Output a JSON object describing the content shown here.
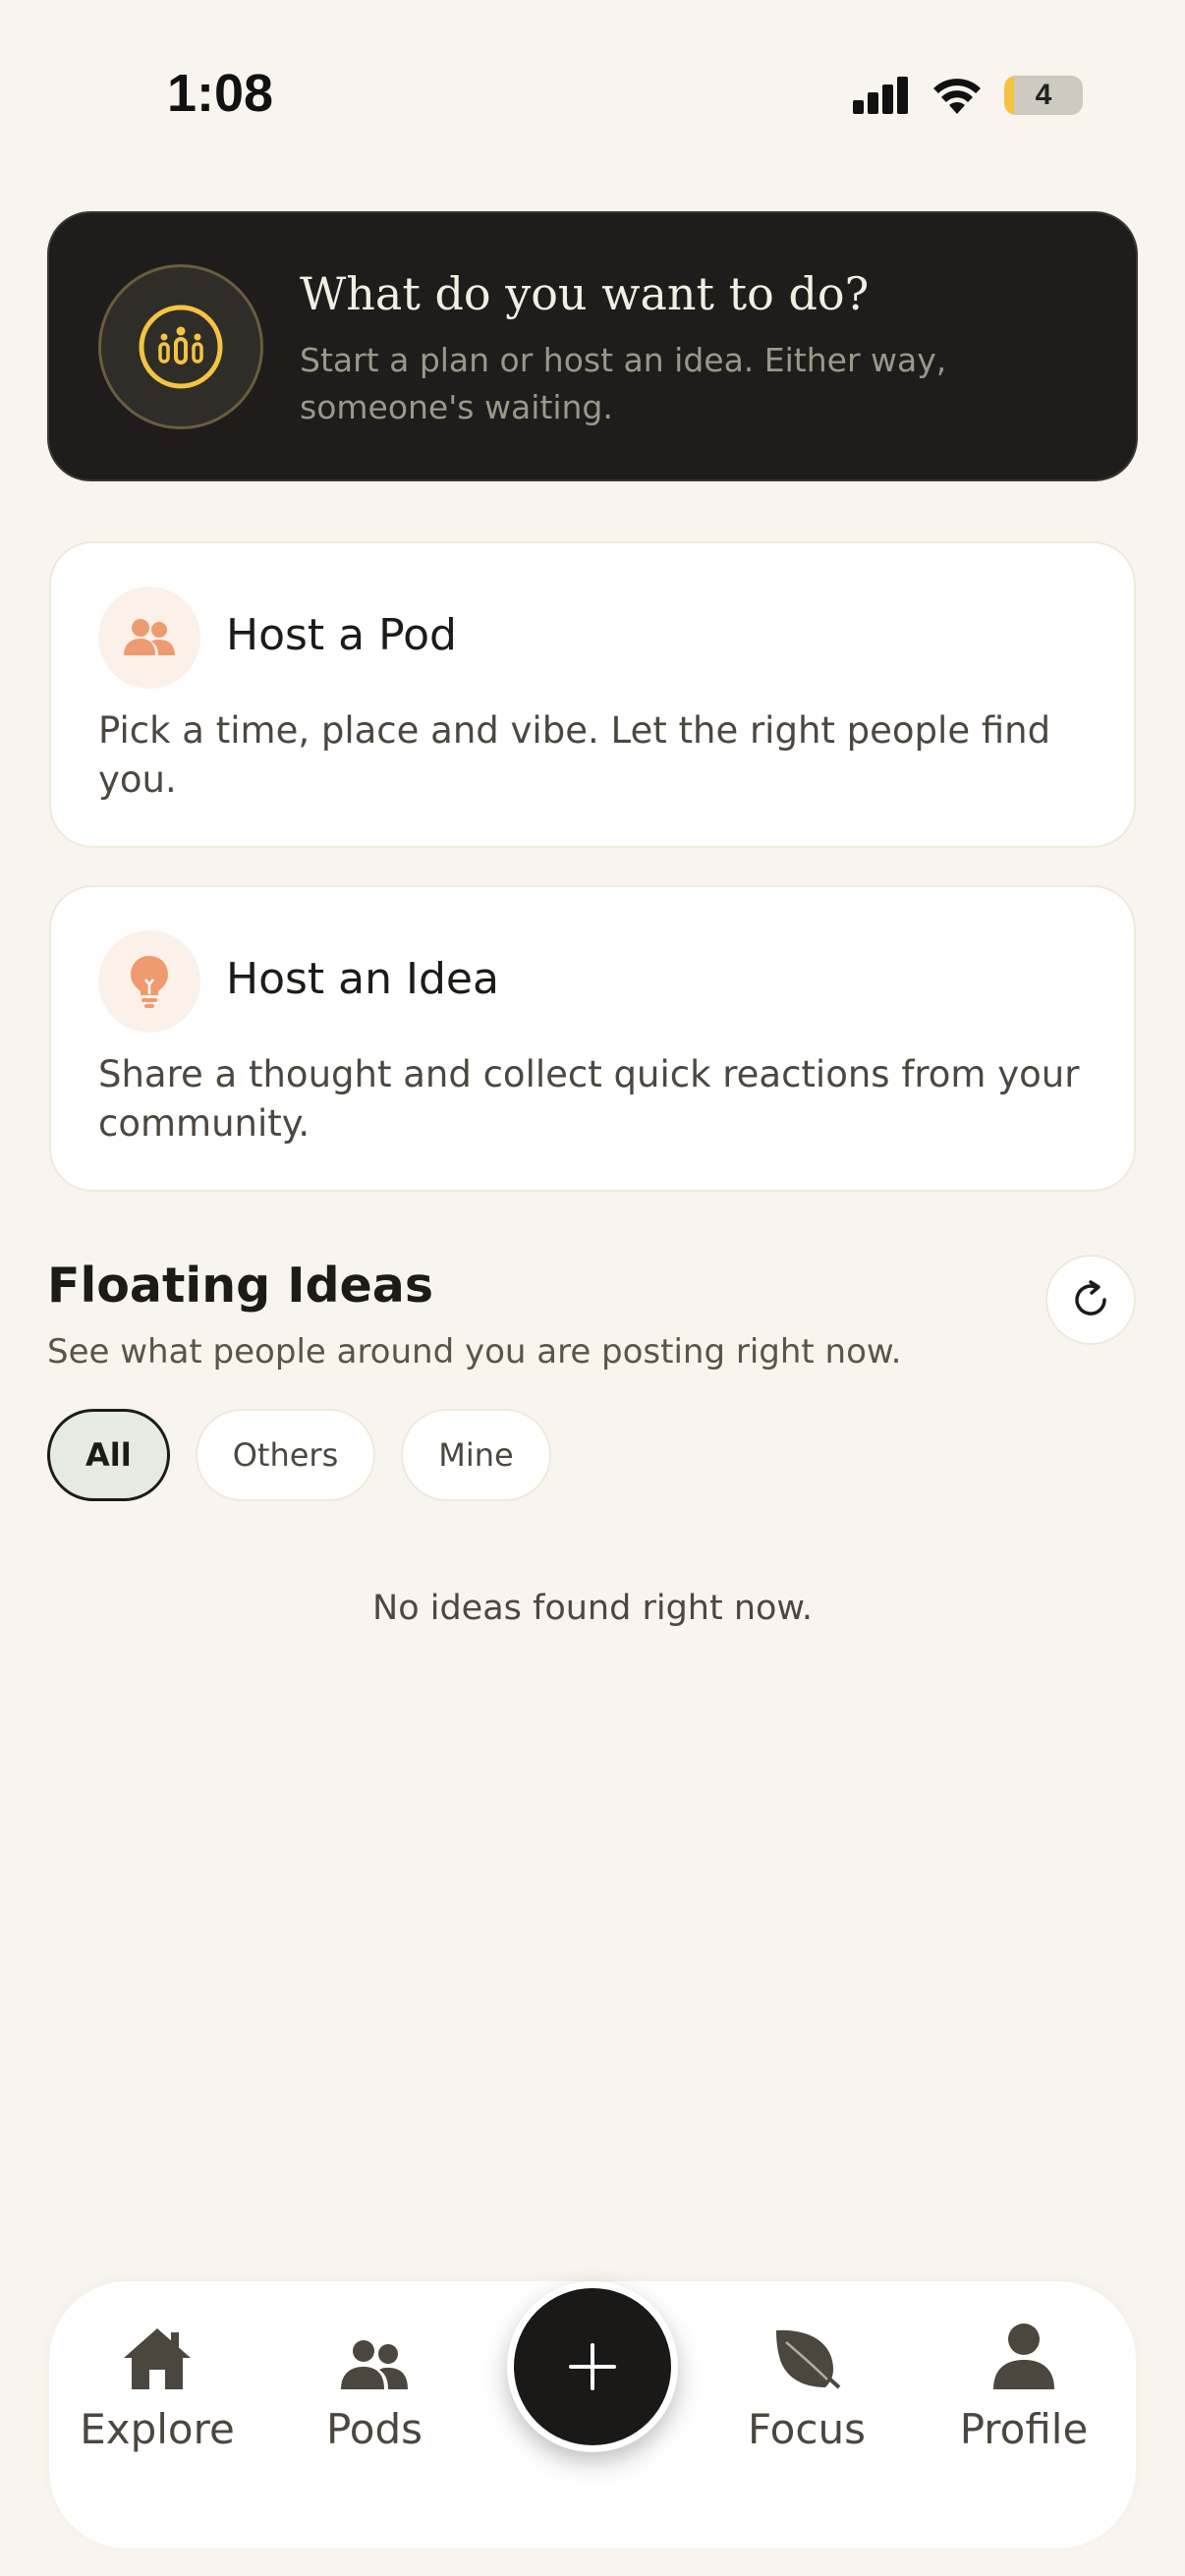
{
  "status_bar": {
    "time": "1:08",
    "battery": "4"
  },
  "hero": {
    "title": "What do you want to do?",
    "subtitle": "Start a plan or host an idea. Either way, someone's waiting.",
    "icon": "group-icon",
    "accent": "#f3c443"
  },
  "options": [
    {
      "title": "Host a Pod",
      "description": "Pick a time, place and vibe. Let the right people find you.",
      "icon": "people-icon"
    },
    {
      "title": "Host an Idea",
      "description": "Share a thought and collect quick reactions from your community.",
      "icon": "lightbulb-icon"
    }
  ],
  "floating_ideas": {
    "title": "Floating Ideas",
    "subtitle": "See what people around you are posting right now.",
    "filters": [
      "All",
      "Others",
      "Mine"
    ],
    "selected_filter": "All",
    "empty_message": "No ideas found right now."
  },
  "bottom_nav": {
    "items": [
      {
        "label": "Explore",
        "icon": "home-icon"
      },
      {
        "label": "Pods",
        "icon": "people-icon"
      },
      {
        "label": "Focus",
        "icon": "leaf-icon"
      },
      {
        "label": "Profile",
        "icon": "person-icon"
      }
    ],
    "fab_icon": "plus-icon"
  },
  "colors": {
    "background": "#f9f5ee",
    "dark": "#1e1d1b",
    "accent_orange": "#ef9b71"
  }
}
